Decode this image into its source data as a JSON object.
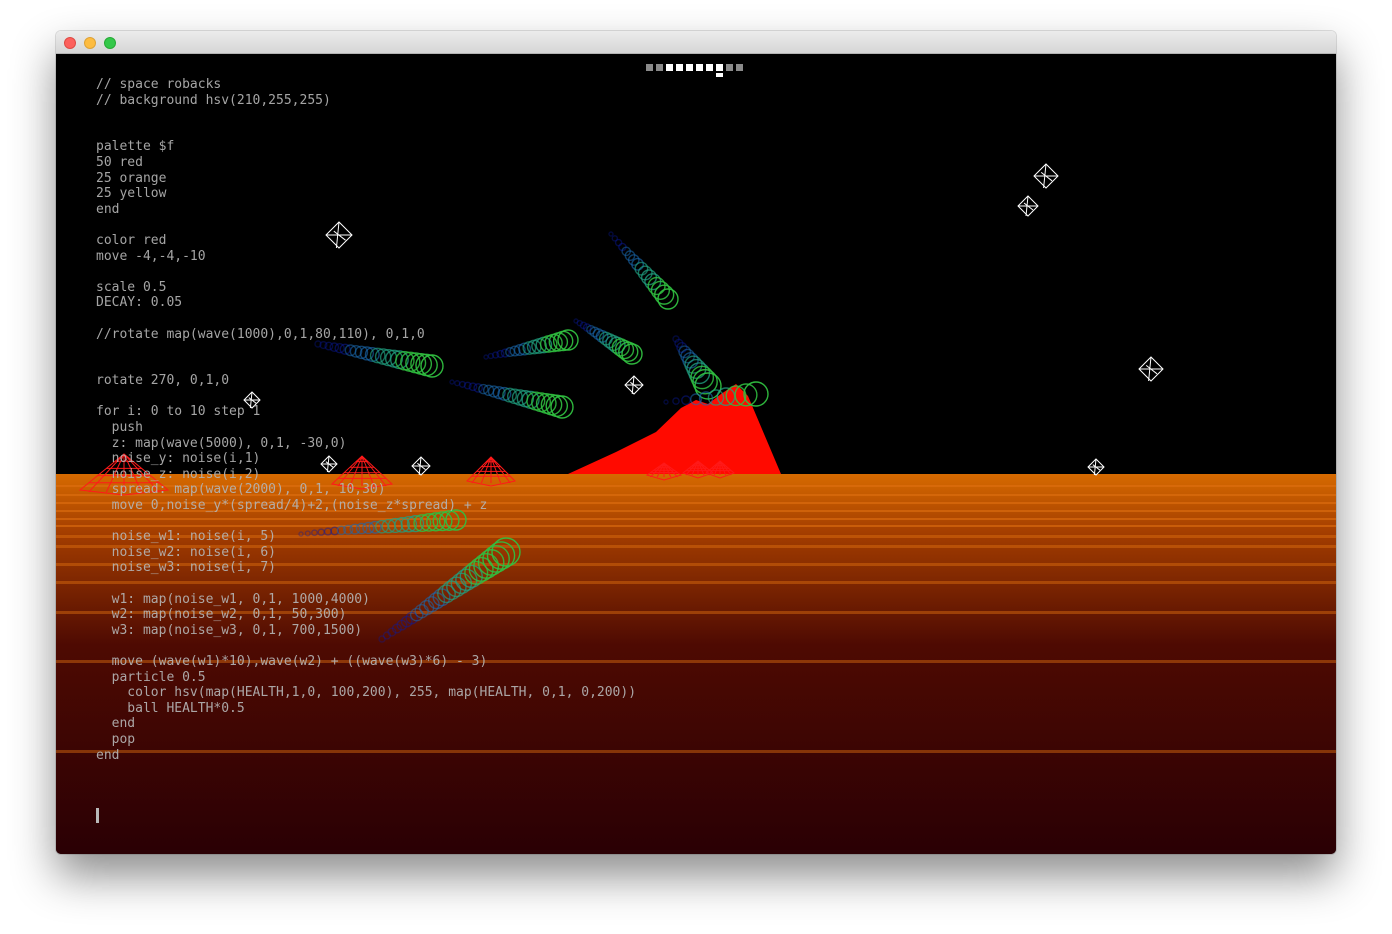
{
  "window": {
    "traffic_lights": [
      "close",
      "minimize",
      "maximize"
    ],
    "colors": {
      "close": "#fc605c",
      "minimize": "#fdbc40",
      "maximize": "#34c84a"
    }
  },
  "visualizer": {
    "background": "#000000",
    "ground_color": "#d66a00",
    "ground_dark": "#2a0004",
    "mountain_color": "#ff0a00",
    "pyramid_color": "#ff1a1a",
    "crystal_color": "#ffffff",
    "ball_colors": [
      "#0a1aa0",
      "#1a6ab0",
      "#20a080",
      "#30c040"
    ],
    "audio_meter": {
      "segments": 10,
      "active_segment": 8
    }
  },
  "editor": {
    "code_lines": [
      "// space robacks",
      "// background hsv(210,255,255)",
      "",
      "",
      "palette $f",
      "50 red",
      "25 orange",
      "25 yellow",
      "end",
      "",
      "color red",
      "move -4,-4,-10",
      "",
      "scale 0.5",
      "DECAY: 0.05",
      "",
      "//rotate map(wave(1000),0,1,80,110), 0,1,0",
      "",
      "",
      "rotate 270, 0,1,0",
      "",
      "for i: 0 to 10 step 1",
      "  push",
      "  z: map(wave(5000), 0,1, -30,0)",
      "  noise_y: noise(i,1)",
      "  noise_z: noise(i,2)",
      "  spread: map(wave(2000), 0,1, 10,30)",
      "  move 0,noise_y*(spread/4)+2,(noise_z*spread) + z",
      "",
      "  noise_w1: noise(i, 5)",
      "  noise_w2: noise(i, 6)",
      "  noise_w3: noise(i, 7)",
      "",
      "  w1: map(noise_w1, 0,1, 1000,4000)",
      "  w2: map(noise_w2, 0,1, 50,300)",
      "  w3: map(noise_w3, 0,1, 700,1500)",
      "",
      "  move (wave(w1)*10),wave(w2) + ((wave(w3)*6) - 3)",
      "  particle 0.5",
      "    color hsv(map(HEALTH,1,0, 100,200), 255, map(HEALTH, 0,1, 0,200))",
      "    ball HEALTH*0.5",
      "  end",
      "  pop",
      "end"
    ]
  }
}
